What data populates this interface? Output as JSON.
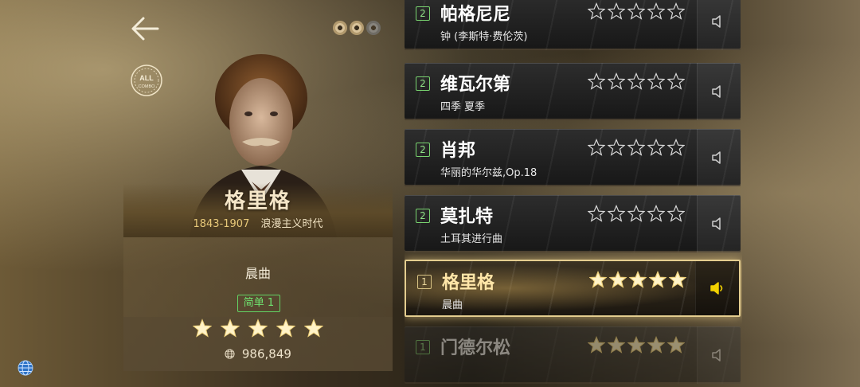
{
  "composer": {
    "name": "格里格",
    "years": "1843-1907",
    "era": "浪漫主义时代",
    "piece": "晨曲",
    "difficulty": "简单 1",
    "stars": 5,
    "plays": "986,849",
    "all_combo_badge": "ALL COMBO"
  },
  "colors": {
    "accent_gold": "#e4cd8f",
    "difficulty_green": "#6fe36f",
    "star_filled": "#fff3c8",
    "active_speaker": "#f3d200"
  },
  "songs": [
    {
      "level": "2",
      "title": "帕格尼尼",
      "subtitle": "钟 (李斯特·费伦茨)",
      "stars": 0,
      "active": false
    },
    {
      "level": "2",
      "title": "维瓦尔第",
      "subtitle": "四季 夏季",
      "stars": 0,
      "active": false
    },
    {
      "level": "2",
      "title": "肖邦",
      "subtitle": "华丽的华尔兹,Op.18",
      "stars": 0,
      "active": false
    },
    {
      "level": "2",
      "title": "莫扎特",
      "subtitle": "土耳其进行曲",
      "stars": 0,
      "active": false
    },
    {
      "level": "1",
      "title": "格里格",
      "subtitle": "晨曲",
      "stars": 5,
      "active": true
    },
    {
      "level": "1",
      "title": "门德尔松",
      "subtitle": "",
      "stars": 5,
      "active": false
    }
  ],
  "icons": {
    "back": "arrow-left-icon",
    "globe": "globe-icon",
    "speaker": "speaker-icon"
  }
}
